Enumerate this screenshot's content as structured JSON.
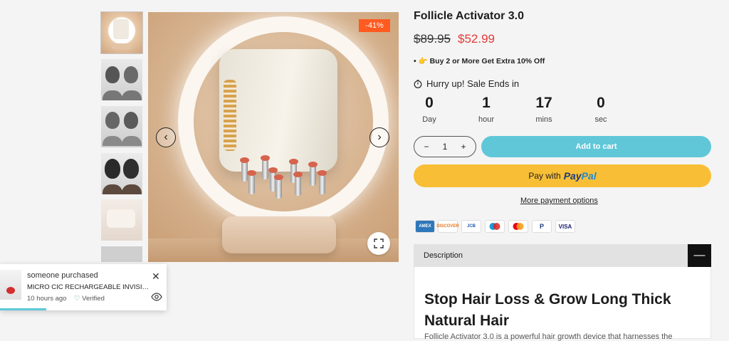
{
  "product": {
    "title": "Follicle Activator 3.0",
    "old_price": "$89.95",
    "new_price": "$52.99",
    "discount_badge": "-41%",
    "promo": "Buy 2 or More Get Extra 10% Off",
    "promo_icon": "hand-point-icon"
  },
  "countdown": {
    "heading": "Hurry up! Sale Ends in",
    "units": [
      {
        "value": "0",
        "label": "Day"
      },
      {
        "value": "1",
        "label": "hour"
      },
      {
        "value": "17",
        "label": "mins"
      },
      {
        "value": "0",
        "label": "sec"
      }
    ]
  },
  "purchase": {
    "qty_minus": "−",
    "qty_value": "1",
    "qty_plus": "+",
    "add_to_cart": "Add to cart",
    "pay_with": "Pay with",
    "paypal_pay": "Pay",
    "paypal_pal": "Pal",
    "more_options": "More payment options"
  },
  "payment_cards": [
    "AMEX",
    "DISCOVER",
    "JCB",
    "Maestro",
    "Mastercard",
    "P",
    "VISA"
  ],
  "description": {
    "tab_label": "Description",
    "heading": "Stop Hair Loss & Grow Long Thick Natural Hair",
    "body": "Follicle Activator 3.0 is a powerful hair growth device that harnesses the"
  },
  "popup": {
    "line1": "someone purchased",
    "line2": "MICRO CIC RECHARGEABLE INVISIBLE HEARING AID",
    "time": "10 hours ago",
    "verified": "Verified"
  },
  "colors": {
    "sale_red": "#e53935",
    "badge_orange": "#ff5a1f",
    "cart_teal": "#5fc7d8",
    "paypal_yellow": "#f8bf36"
  }
}
